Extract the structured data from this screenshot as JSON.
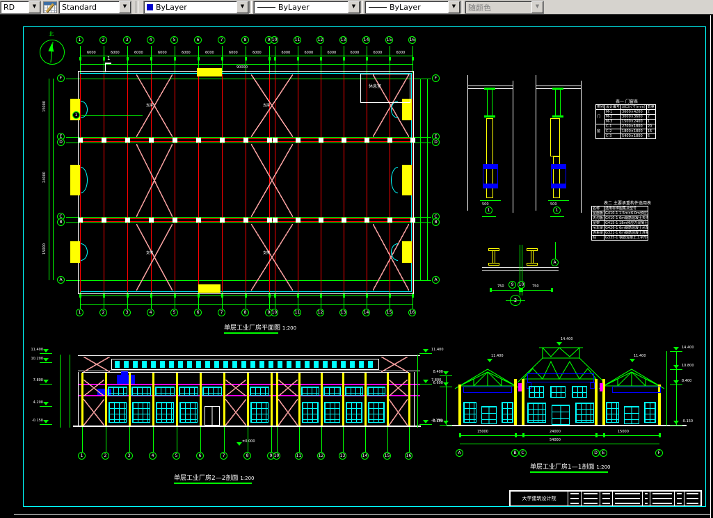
{
  "toolbar": {
    "layer_combo": "RD",
    "style_label": "Standard",
    "color_label": "ByLayer",
    "linetype_label": "ByLayer",
    "lineweight_label": "ByLayer",
    "plotstyle_label": "随颜色",
    "arrow": "▼"
  },
  "plan": {
    "title": "单层工业厂房平面图",
    "scale": "1:200",
    "north_label": "北",
    "room_label": "休息室",
    "brace_label": "支撑",
    "bay_dim": "6000",
    "total_dim": "90000",
    "row_dims": [
      "15000",
      "24000",
      "15000"
    ],
    "detail_bubble": "1",
    "cut_label": "1",
    "column_axes": [
      "1",
      "2",
      "3",
      "4",
      "5",
      "6",
      "7",
      "8",
      "9",
      "10",
      "11",
      "12",
      "13",
      "14",
      "15",
      "16"
    ],
    "row_axes": [
      "F",
      "E",
      "D",
      "C",
      "B",
      "A"
    ]
  },
  "details": {
    "marker_left": "1",
    "marker_right": "1",
    "rail_axes": [
      "9",
      "10"
    ],
    "rail_detail": "3",
    "rail_axis_ref": "A",
    "rail_dims": [
      "750",
      "750"
    ],
    "base_dim": "500"
  },
  "tables": {
    "table1": {
      "title": "表一  门窗表",
      "headers": [
        "类别",
        "设计编号",
        "洞口尺寸(mm)",
        "数量"
      ],
      "groups": [
        "门",
        "窗"
      ],
      "rows": [
        [
          "M-1",
          "3600×4200",
          "2"
        ],
        [
          "M-2",
          "3000×3600",
          "2"
        ],
        [
          "M-3",
          "1500×2400",
          "1"
        ],
        [
          "C-1",
          "2700×1800",
          "20"
        ],
        [
          "C-2",
          "1800×1800",
          "16"
        ],
        [
          "C-3",
          "5400×1800",
          "6"
        ]
      ]
    },
    "table2": {
      "title": "表二  主要承重构件选用表",
      "headers": [
        "名称",
        "选用标准图集及型号"
      ],
      "rows": [
        [
          "屋面板",
          "G410-1 1.5m×6.0m预应力混凝土屋面板"
        ],
        [
          "天沟板",
          "G410-1 6m钢筋混凝土天沟板"
        ],
        [
          "屋架",
          "G415-1 18m预应力混凝土折线形屋架"
        ],
        [
          "吊车梁",
          "G426-1 6m钢筋混凝土吊车梁"
        ],
        [
          "连系梁",
          "G321-1 6m钢筋混凝土连系梁"
        ],
        [
          "柱",
          "G335-1 钢筋混凝土工字形柱"
        ]
      ]
    }
  },
  "section22": {
    "title": "单层工业厂房2—2剖面",
    "scale": "1:200",
    "elev_left": [
      "11.400",
      "10.200",
      "7.800",
      "4.200",
      "-0.150"
    ],
    "elev_right": [
      "11.400",
      "7.800",
      "-0.150"
    ],
    "ground_label": "±0.000"
  },
  "section11": {
    "title": "单层工业厂房1—1剖面",
    "scale": "1:200",
    "axes": [
      "A",
      "B",
      "C",
      "D",
      "E",
      "F"
    ],
    "span_dims": [
      "15000",
      "24000",
      "15000"
    ],
    "total_dim": "54000",
    "elev_left": [
      "8.400",
      "6.600",
      "-0.150"
    ],
    "elev_right": [
      "14.400",
      "10.800",
      "8.400",
      "-0.150"
    ],
    "roof_elevs": [
      "11.400",
      "14.400",
      "11.400"
    ]
  },
  "titleblock": {
    "org": "大学建筑设计院"
  }
}
